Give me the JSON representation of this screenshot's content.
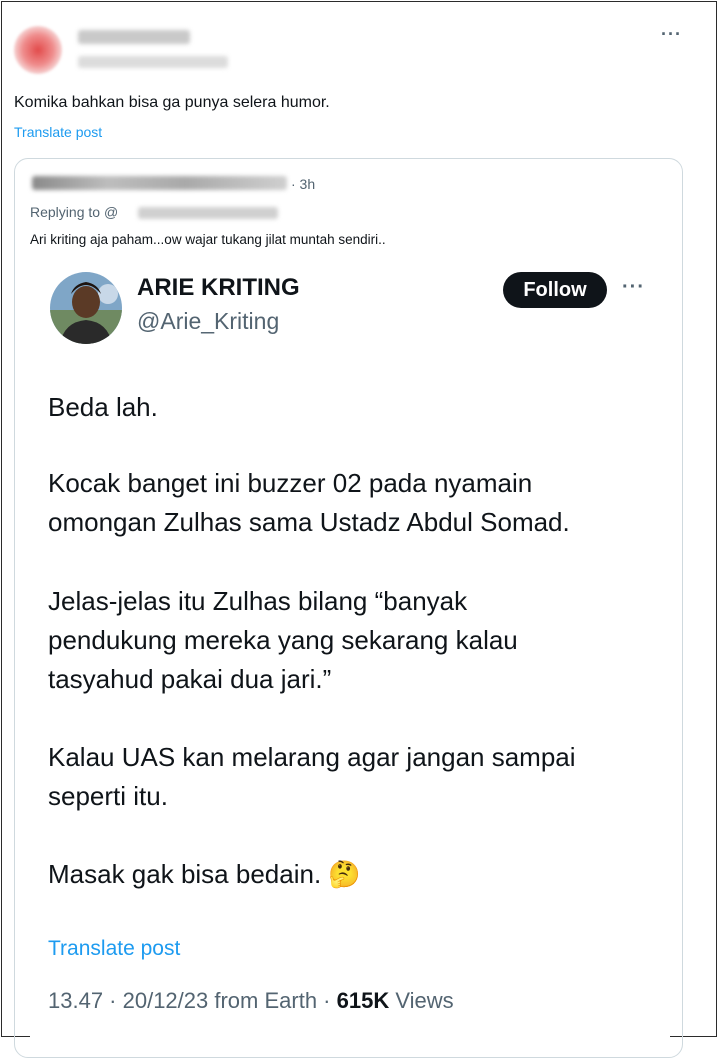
{
  "outer_post": {
    "text": "Komika bahkan bisa ga punya selera humor.",
    "translate": "Translate post",
    "more": "···"
  },
  "quoted_post": {
    "time": "· 3h",
    "replying_prefix": "Replying to",
    "replying_handle": "@",
    "text": "Ari kriting aja paham...ow wajar tukang jilat muntah sendiri.."
  },
  "screenshot_tweet": {
    "name": "ARIE KRITING",
    "handle": "@Arie_Kriting",
    "follow_label": "Follow",
    "more": "···",
    "paragraphs": [
      {
        "lines": [
          "Beda lah."
        ]
      },
      {
        "lines": [
          "Kocak banget ini buzzer 02 pada nyamain",
          "omongan Zulhas sama Ustadz Abdul Somad."
        ]
      },
      {
        "lines": [
          "Jelas-jelas itu Zulhas bilang “banyak",
          "pendukung mereka yang sekarang kalau",
          "tasyahud pakai dua jari.”"
        ]
      },
      {
        "lines": [
          "Kalau UAS kan melarang agar jangan sampai",
          "seperti itu."
        ]
      },
      {
        "lines": [
          "Masak gak bisa bedain. 🤔"
        ]
      }
    ],
    "translate": "Translate post",
    "time": "13.47 · 20/12/23 from Earth ·",
    "views_count": "615K",
    "views_label": "Views"
  }
}
